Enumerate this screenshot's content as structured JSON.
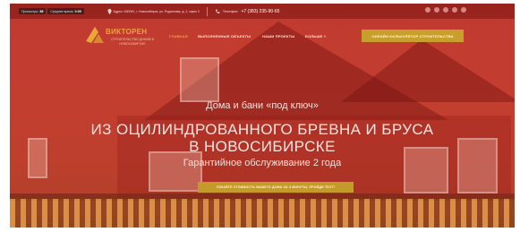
{
  "topbar": {
    "visits_label": "Просмотры",
    "visits_value": "86",
    "avg_time_label": "Среднее время",
    "avg_time_value": "0:09",
    "address": "Адрес: 630091, г. Новосибирск, ул. Родионова, д. 2, офис 3",
    "phone_label": "Телефон:",
    "phone": "+7 (383) 235-90-65"
  },
  "logo": {
    "name": "ВИКТОРЕН",
    "tagline": "СТРОИТЕЛЬСТВО ДОМОВ В НОВОСИБИРСКЕ"
  },
  "nav": {
    "items": [
      {
        "label": "ГЛАВНАЯ",
        "active": true
      },
      {
        "label": "ВЫПОЛНЕННЫЕ ОБЪЕКТЫ",
        "active": false
      },
      {
        "label": "НАШИ ПРОЕКТЫ",
        "active": false
      },
      {
        "label": "БОЛЬШЕ ˅",
        "active": false
      }
    ],
    "cta": "ОНЛАЙН КАЛЬКУЛЯТОР СТРОИТЕЛЬСТВА"
  },
  "hero": {
    "subheading": "Дома и бани «под ключ»",
    "heading_line1": "ИЗ ОЦИЛИНДРОВАННОГО БРЕВНА И БРУСА",
    "heading_line2": "В НОВОСИБИРСКЕ",
    "warranty": "Гарантийное обслуживание 2 года",
    "cta": "УЗНАЙТЕ СТОИМОСТЬ ВАШЕГО ДОМА ЗА 3 МИНУТЫ, ПРОЙДЯ ТЕСТ!"
  },
  "colors": {
    "overlay": "#be231e",
    "accent": "#c89f2c",
    "logo": "#e8a53a"
  },
  "icons": [
    "location-icon",
    "phone-icon",
    "vk-icon",
    "facebook-icon",
    "instagram-icon",
    "ok-icon",
    "youtube-icon"
  ]
}
